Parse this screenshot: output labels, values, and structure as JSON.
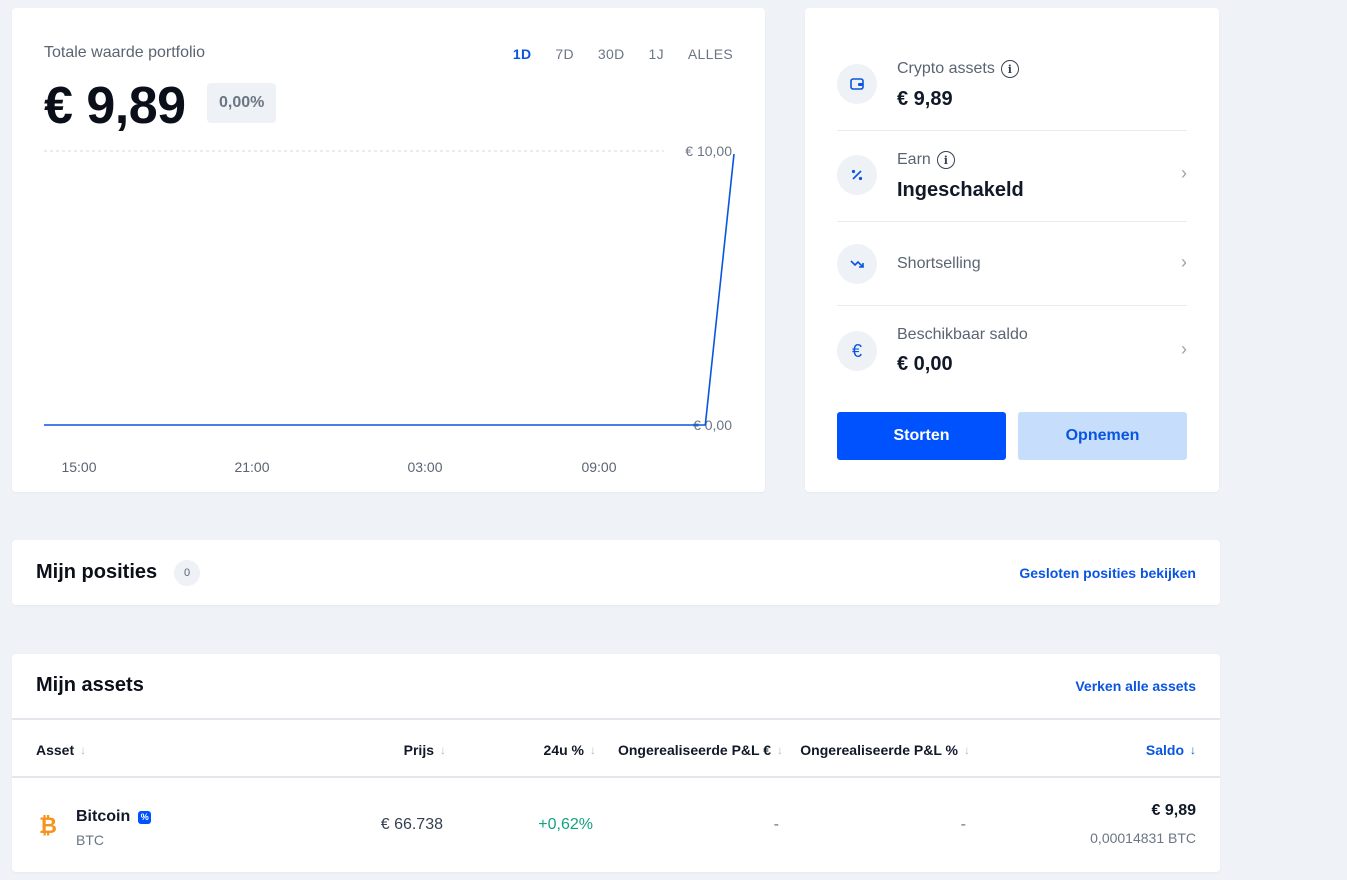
{
  "portfolio": {
    "title": "Totale waarde portfolio",
    "value": "€ 9,89",
    "change": "0,00%",
    "ranges": [
      "1D",
      "7D",
      "30D",
      "1J",
      "ALLES"
    ],
    "active_range": "1D"
  },
  "chart_data": {
    "type": "line",
    "x_ticks": [
      "15:00",
      "21:00",
      "03:00",
      "09:00"
    ],
    "y_ticks": [
      "€ 10,00",
      "€ 0,00"
    ],
    "ylim": [
      0,
      10
    ],
    "series": [
      {
        "values": [
          0,
          0,
          0,
          0,
          0,
          0,
          0,
          0,
          0,
          0,
          0,
          0,
          0,
          0,
          0,
          0,
          0,
          0,
          0,
          0,
          0,
          0,
          0,
          0,
          9.89
        ]
      }
    ],
    "color": "#0a55e0"
  },
  "summary": {
    "crypto_assets": {
      "label": "Crypto assets",
      "value": "€ 9,89"
    },
    "earn": {
      "label": "Earn",
      "value": "Ingeschakeld"
    },
    "shortselling": {
      "label": "Shortselling"
    },
    "saldo": {
      "label": "Beschikbaar saldo",
      "value": "€ 0,00"
    },
    "deposit_label": "Storten",
    "withdraw_label": "Opnemen",
    "chevron": "›",
    "info_glyph": "i",
    "euro_glyph": "€"
  },
  "positions": {
    "title": "Mijn posities",
    "count": "0",
    "link": "Gesloten posities bekijken"
  },
  "assets": {
    "title": "Mijn assets",
    "link": "Verken alle assets",
    "columns": {
      "asset": "Asset",
      "price": "Prijs",
      "change24": "24u %",
      "pnl_eur": "Ongerealiseerde P&L €",
      "pnl_pct": "Ongerealiseerde P&L %",
      "saldo": "Saldo"
    },
    "sort_arrow": "↓",
    "rows": [
      {
        "name": "Bitcoin",
        "symbol": "BTC",
        "price": "€ 66.738",
        "change24": "+0,62%",
        "pnl_eur": "-",
        "pnl_pct": "-",
        "saldo": "€ 9,89",
        "saldo_crypto": "0,00014831 BTC",
        "icon": "bitcoin-icon",
        "change_color": "#10a37f",
        "coin_color": "#f7931a"
      }
    ]
  }
}
